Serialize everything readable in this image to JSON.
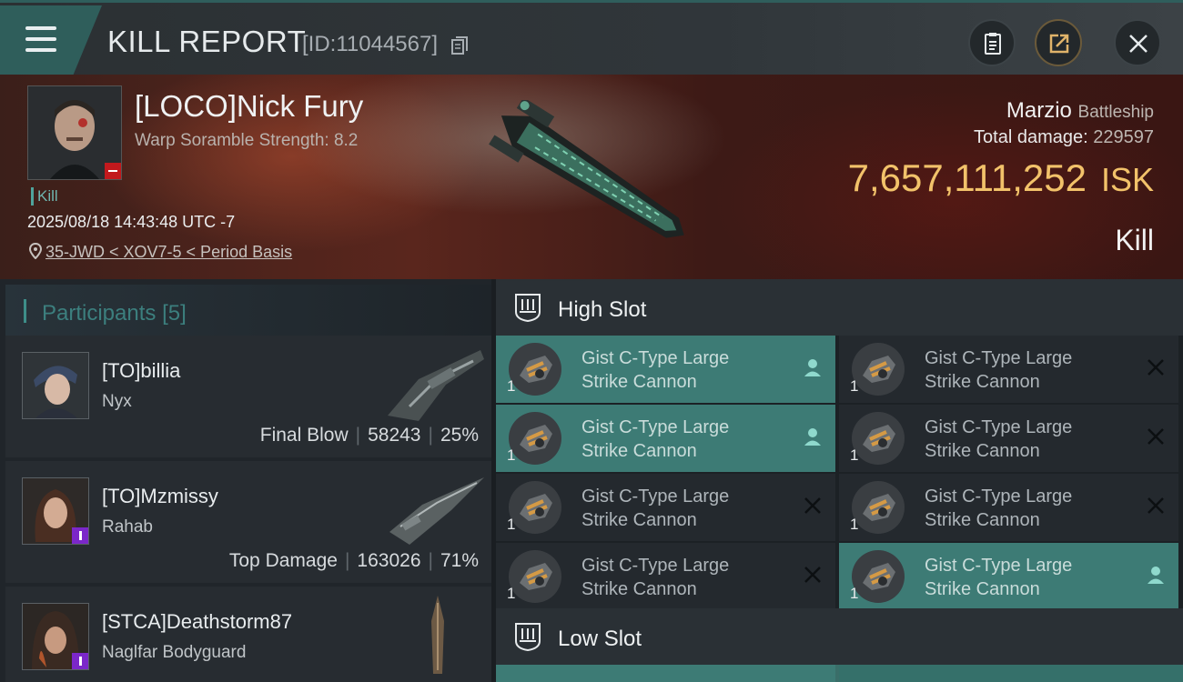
{
  "header": {
    "title": "KILL REPORT",
    "report_id": "[ID:11044567]",
    "icons": [
      "menu-icon",
      "copy-icon",
      "clipboard-icon",
      "share-icon",
      "close-icon"
    ]
  },
  "victim": {
    "name": "[LOCO]Nick Fury",
    "subtitle": "Warp Soramble Strength: 8.2",
    "tag": "Kill",
    "datetime": "2025/08/18 14:43:48 UTC -7",
    "location": "35-JWD < XOV7-5 < Period Basis",
    "ship_name": "Marzio",
    "ship_class": "Battleship",
    "total_damage_label": "Total damage:",
    "total_damage": "229597",
    "isk_value": "7,657,111,252",
    "isk_unit": "ISK",
    "result": "Kill"
  },
  "participants": {
    "title": "Participants",
    "count": "[5]",
    "items": [
      {
        "name": "[TO]billia",
        "ship": "Nyx",
        "role": "Final Blow",
        "damage": "58243",
        "percent": "25%"
      },
      {
        "name": "[TO]Mzmissy",
        "ship": "Rahab",
        "role": "Top Damage",
        "damage": "163026",
        "percent": "71%"
      },
      {
        "name": "[STCA]Deathstorm87",
        "ship": "Naglfar Bodyguard"
      }
    ]
  },
  "fittings": {
    "high_slot_label": "High Slot",
    "low_slot_label": "Low Slot",
    "high_slot": [
      {
        "name_line1": "Gist C-Type Large",
        "name_line2": "Strike Cannon",
        "qty": "1",
        "status": "dropped"
      },
      {
        "name_line1": "Gist C-Type Large",
        "name_line2": "Strike Cannon",
        "qty": "1",
        "status": "destroyed"
      },
      {
        "name_line1": "Gist C-Type Large",
        "name_line2": "Strike Cannon",
        "qty": "1",
        "status": "dropped"
      },
      {
        "name_line1": "Gist C-Type Large",
        "name_line2": "Strike Cannon",
        "qty": "1",
        "status": "destroyed"
      },
      {
        "name_line1": "Gist C-Type Large",
        "name_line2": "Strike Cannon",
        "qty": "1",
        "status": "destroyed"
      },
      {
        "name_line1": "Gist C-Type Large",
        "name_line2": "Strike Cannon",
        "qty": "1",
        "status": "destroyed"
      },
      {
        "name_line1": "Gist C-Type Large",
        "name_line2": "Strike Cannon",
        "qty": "1",
        "status": "destroyed"
      },
      {
        "name_line1": "Gist C-Type Large",
        "name_line2": "Strike Cannon",
        "qty": "1",
        "status": "dropped"
      }
    ]
  },
  "colors": {
    "accent_teal": "#3d7b75",
    "isk_gold": "#f2c26a",
    "status_red": "#c2191d",
    "badge_purple": "#7b27c9"
  }
}
